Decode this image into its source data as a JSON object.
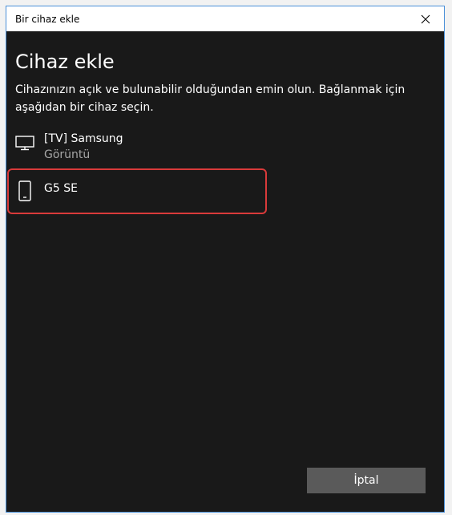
{
  "window": {
    "title": "Bir cihaz ekle",
    "close_icon": "close-icon"
  },
  "main": {
    "heading": "Cihaz ekle",
    "description": "Cihazınızın açık ve bulunabilir olduğundan emin olun. Bağlanmak için aşağıdan bir cihaz seçin."
  },
  "devices": [
    {
      "name": "[TV] Samsung",
      "type": "Görüntü",
      "icon": "monitor-icon"
    },
    {
      "name": "G5 SE",
      "type": "",
      "icon": "phone-icon",
      "highlighted": true
    }
  ],
  "footer": {
    "cancel_label": "İptal"
  },
  "colors": {
    "dialog_bg": "#191919",
    "highlight": "#d93a3a",
    "button_bg": "#5a5a5a",
    "secondary_text": "#a6a6a6"
  }
}
